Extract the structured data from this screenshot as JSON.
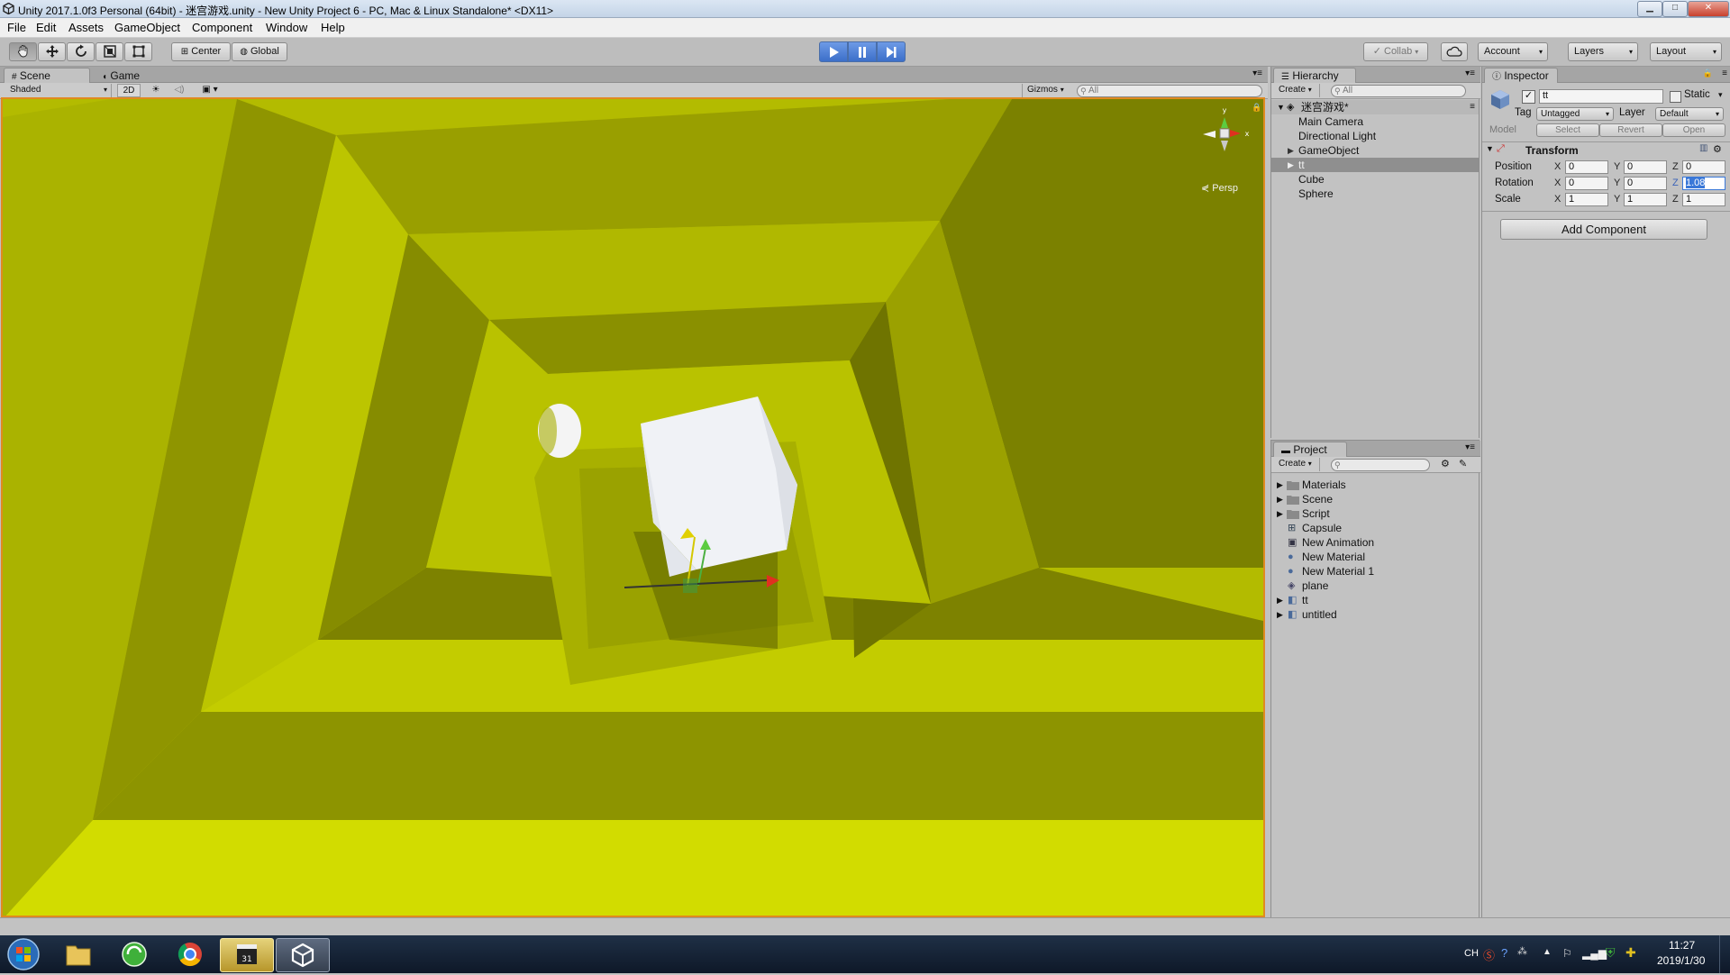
{
  "window": {
    "title": "Unity 2017.1.0f3 Personal (64bit) - 迷宫游戏.unity - New Unity Project 6 - PC, Mac & Linux Standalone* <DX11>",
    "controls": [
      "minimize",
      "maximize",
      "close"
    ]
  },
  "menu": [
    "File",
    "Edit",
    "Assets",
    "GameObject",
    "Component",
    "Window",
    "Help"
  ],
  "toolbar": {
    "tools": [
      "hand-icon",
      "move-icon",
      "rotate-icon",
      "scale-icon",
      "rect-icon"
    ],
    "pivot_label": "Center",
    "space_label": "Global",
    "play_state": "playing",
    "collab_label": "Collab",
    "account_label": "Account",
    "layers_label": "Layers",
    "layout_label": "Layout"
  },
  "scene_panel": {
    "tabs": [
      "Scene",
      "Game"
    ],
    "shading_mode": "Shaded",
    "toggle_2d": "2D",
    "gizmos_label": "Gizmos",
    "search_placeholder": "All",
    "projection_label": "Persp"
  },
  "hierarchy": {
    "tab": "Hierarchy",
    "create_label": "Create",
    "search_placeholder": "All",
    "scene_name": "迷宫游戏*",
    "items": [
      {
        "label": "Main Camera",
        "expandable": false,
        "selected": false
      },
      {
        "label": "Directional Light",
        "expandable": false,
        "selected": false
      },
      {
        "label": "GameObject",
        "expandable": true,
        "selected": false
      },
      {
        "label": "tt",
        "expandable": true,
        "selected": true
      },
      {
        "label": "Cube",
        "expandable": false,
        "selected": false
      },
      {
        "label": "Sphere",
        "expandable": false,
        "selected": false
      }
    ]
  },
  "project": {
    "tab": "Project",
    "create_label": "Create",
    "items": [
      {
        "label": "Materials",
        "icon": "folder-icon",
        "expandable": true
      },
      {
        "label": "Scene",
        "icon": "folder-icon",
        "expandable": true
      },
      {
        "label": "Script",
        "icon": "folder-icon",
        "expandable": true
      },
      {
        "label": "Capsule",
        "icon": "prefab-icon",
        "expandable": false
      },
      {
        "label": "New Animation",
        "icon": "animation-icon",
        "expandable": false
      },
      {
        "label": "New Material",
        "icon": "material-icon",
        "expandable": false
      },
      {
        "label": "New Material 1",
        "icon": "material-icon",
        "expandable": false
      },
      {
        "label": "plane",
        "icon": "scene-asset-icon",
        "expandable": false
      },
      {
        "label": "tt",
        "icon": "model-icon",
        "expandable": true
      },
      {
        "label": "untitled",
        "icon": "model-icon",
        "expandable": true
      }
    ]
  },
  "inspector": {
    "tab": "Inspector",
    "object_name": "tt",
    "active": true,
    "static_label": "Static",
    "tag_label": "Tag",
    "tag_value": "Untagged",
    "layer_label": "Layer",
    "layer_value": "Default",
    "model_label": "Model",
    "model_buttons": [
      "Select",
      "Revert",
      "Open"
    ],
    "transform_title": "Transform",
    "position": {
      "label": "Position",
      "x": "0",
      "y": "0",
      "z": "0"
    },
    "rotation": {
      "label": "Rotation",
      "x": "0",
      "y": "0",
      "z": "1.08"
    },
    "scale": {
      "label": "Scale",
      "x": "1",
      "y": "1",
      "z": "1"
    },
    "add_component_label": "Add Component"
  },
  "taskbar": {
    "language": "CH",
    "time": "11:27",
    "date": "2019/1/30"
  },
  "colors": {
    "scene_border": "#e08a20",
    "play_blue": "#3c6fc9",
    "maze_light": "#c9d200",
    "maze_dark": "#7f7f00"
  }
}
